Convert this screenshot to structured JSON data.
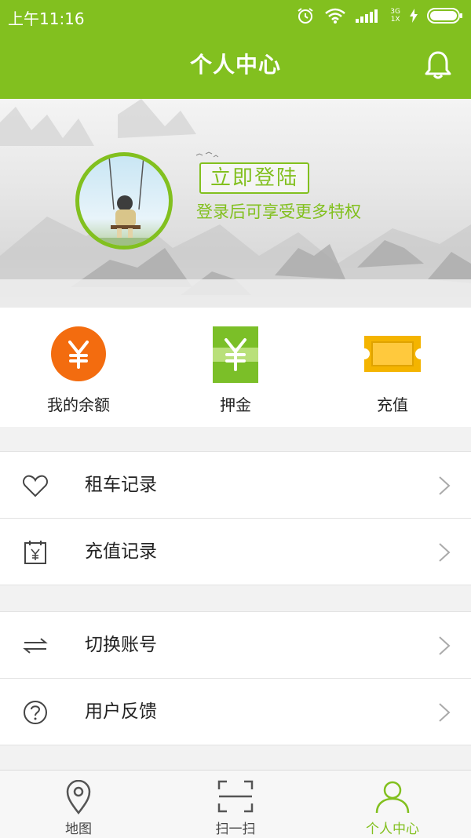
{
  "status_bar": {
    "time": "上午11:16",
    "network_top": "3G",
    "network_bottom": "1X"
  },
  "header": {
    "title": "个人中心"
  },
  "profile": {
    "login_button": "立即登陆",
    "login_hint": "登录后可享受更多特权"
  },
  "wallet": {
    "items": [
      {
        "label": "我的余额",
        "icon": "yen-circle-icon",
        "color": "#f36c0f"
      },
      {
        "label": "押金",
        "icon": "yen-card-icon",
        "color": "#7bbf28"
      },
      {
        "label": "充值",
        "icon": "ticket-icon",
        "color": "#f4b400"
      }
    ]
  },
  "menu": {
    "group1": [
      {
        "label": "租车记录",
        "icon": "heart-icon"
      },
      {
        "label": "充值记录",
        "icon": "calendar-yen-icon"
      }
    ],
    "group2": [
      {
        "label": "切换账号",
        "icon": "swap-arrows-icon"
      },
      {
        "label": "用户反馈",
        "icon": "question-circle-icon"
      }
    ]
  },
  "tabbar": {
    "items": [
      {
        "label": "地图",
        "icon": "map-pin-icon"
      },
      {
        "label": "扫一扫",
        "icon": "scan-icon"
      },
      {
        "label": "个人中心",
        "icon": "person-icon",
        "active": true
      }
    ]
  },
  "colors": {
    "brand_green": "#82c01f",
    "orange": "#f36c0f",
    "yellow": "#f4b400"
  }
}
